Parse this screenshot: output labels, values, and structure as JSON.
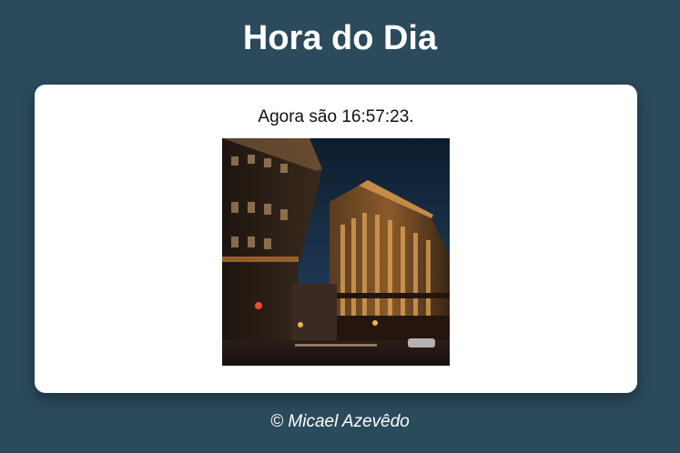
{
  "header": {
    "title": "Hora do Dia"
  },
  "main": {
    "time_message": "Agora são 16:57:23."
  },
  "footer": {
    "credit": "© Micael Azevêdo"
  },
  "colors": {
    "background": "#2b4a5c",
    "card": "#ffffff",
    "text": "#111111"
  }
}
